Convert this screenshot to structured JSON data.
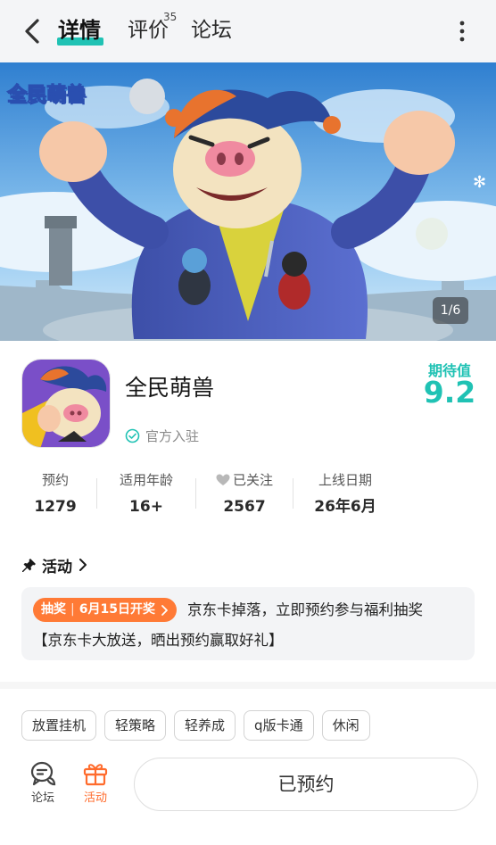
{
  "header": {
    "back_icon": "chevron-left-icon",
    "tabs": [
      {
        "label": "详情",
        "active": true
      },
      {
        "label": "评价",
        "count": "35"
      },
      {
        "label": "论坛"
      }
    ],
    "more_icon": "more-vertical-icon",
    "accent_color": "#20c2b4"
  },
  "banner": {
    "logo_text": "全民萌兽",
    "pager": "1/6"
  },
  "game": {
    "name": "全民萌兽",
    "verified_label": "官方入驻",
    "expect_label": "期待值",
    "expect_score": "9.2"
  },
  "stats": [
    {
      "label": "预约",
      "value": "1279"
    },
    {
      "label": "适用年龄",
      "value": "16+"
    },
    {
      "label": "已关注",
      "value": "2567",
      "icon": "heart-icon"
    },
    {
      "label": "上线日期",
      "value": "26年6月"
    }
  ],
  "activity": {
    "title": "活动",
    "badge_type": "抽奖",
    "badge_date": "6月15日开奖",
    "badge_color": "#ff7a36",
    "line1": "京东卡掉落，立即预约参与福利抽奖",
    "line2": "【京东卡大放送，晒出预约赢取好礼】"
  },
  "tags": [
    "放置挂机",
    "轻策略",
    "轻养成",
    "q版卡通",
    "休闲"
  ],
  "bottom_bar": {
    "forum_label": "论坛",
    "activity_label": "活动",
    "activity_color": "#ff6b2c",
    "reserve_label": "已预约"
  }
}
